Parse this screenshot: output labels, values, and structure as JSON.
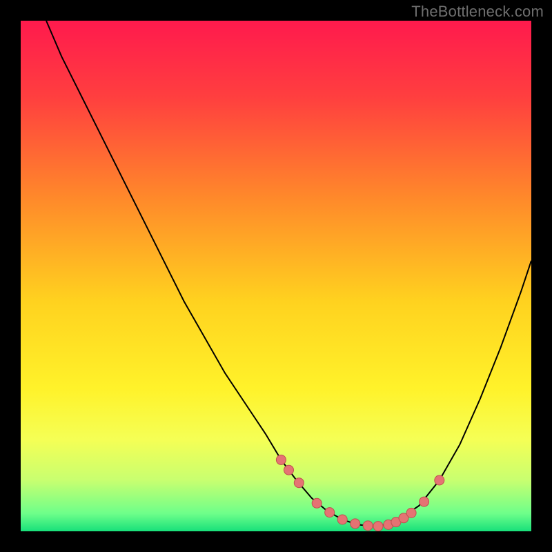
{
  "watermark": "TheBottleneck.com",
  "colors": {
    "page_bg": "#000000",
    "watermark": "#6e6e6e",
    "curve": "#000000",
    "dot_fill": "#e57373",
    "dot_stroke": "#c05050",
    "gradient_stops": [
      {
        "offset": 0.0,
        "color": "#ff1a4d"
      },
      {
        "offset": 0.15,
        "color": "#ff3f3f"
      },
      {
        "offset": 0.35,
        "color": "#ff8a2a"
      },
      {
        "offset": 0.55,
        "color": "#ffd21f"
      },
      {
        "offset": 0.72,
        "color": "#fff22a"
      },
      {
        "offset": 0.82,
        "color": "#f5ff55"
      },
      {
        "offset": 0.9,
        "color": "#c8ff70"
      },
      {
        "offset": 0.965,
        "color": "#6eff8a"
      },
      {
        "offset": 1.0,
        "color": "#18e07a"
      }
    ]
  },
  "chart_data": {
    "type": "line",
    "title": "",
    "xlabel": "",
    "ylabel": "",
    "xlim": [
      0,
      100
    ],
    "ylim": [
      0,
      100
    ],
    "x": [
      5,
      8,
      12,
      16,
      20,
      24,
      28,
      32,
      36,
      40,
      44,
      48,
      51,
      54,
      57,
      60,
      63,
      66,
      69,
      72,
      74,
      78,
      82,
      86,
      90,
      94,
      98,
      100
    ],
    "values": [
      100,
      93,
      85,
      77,
      69,
      61,
      53,
      45,
      38,
      31,
      25,
      19,
      14,
      10,
      6.5,
      4,
      2.3,
      1.3,
      1,
      1.3,
      2.3,
      5,
      10,
      17,
      26,
      36,
      47,
      53
    ],
    "highlight_points_x": [
      51,
      52.5,
      54.5,
      58,
      60.5,
      63,
      65.5,
      68,
      70,
      72,
      73.5,
      75,
      76.5,
      79,
      82
    ],
    "highlight_points_y": [
      14,
      12,
      9.5,
      5.5,
      3.7,
      2.3,
      1.5,
      1.1,
      1,
      1.3,
      1.8,
      2.6,
      3.6,
      5.8,
      10
    ],
    "grid": false,
    "legend": false
  }
}
